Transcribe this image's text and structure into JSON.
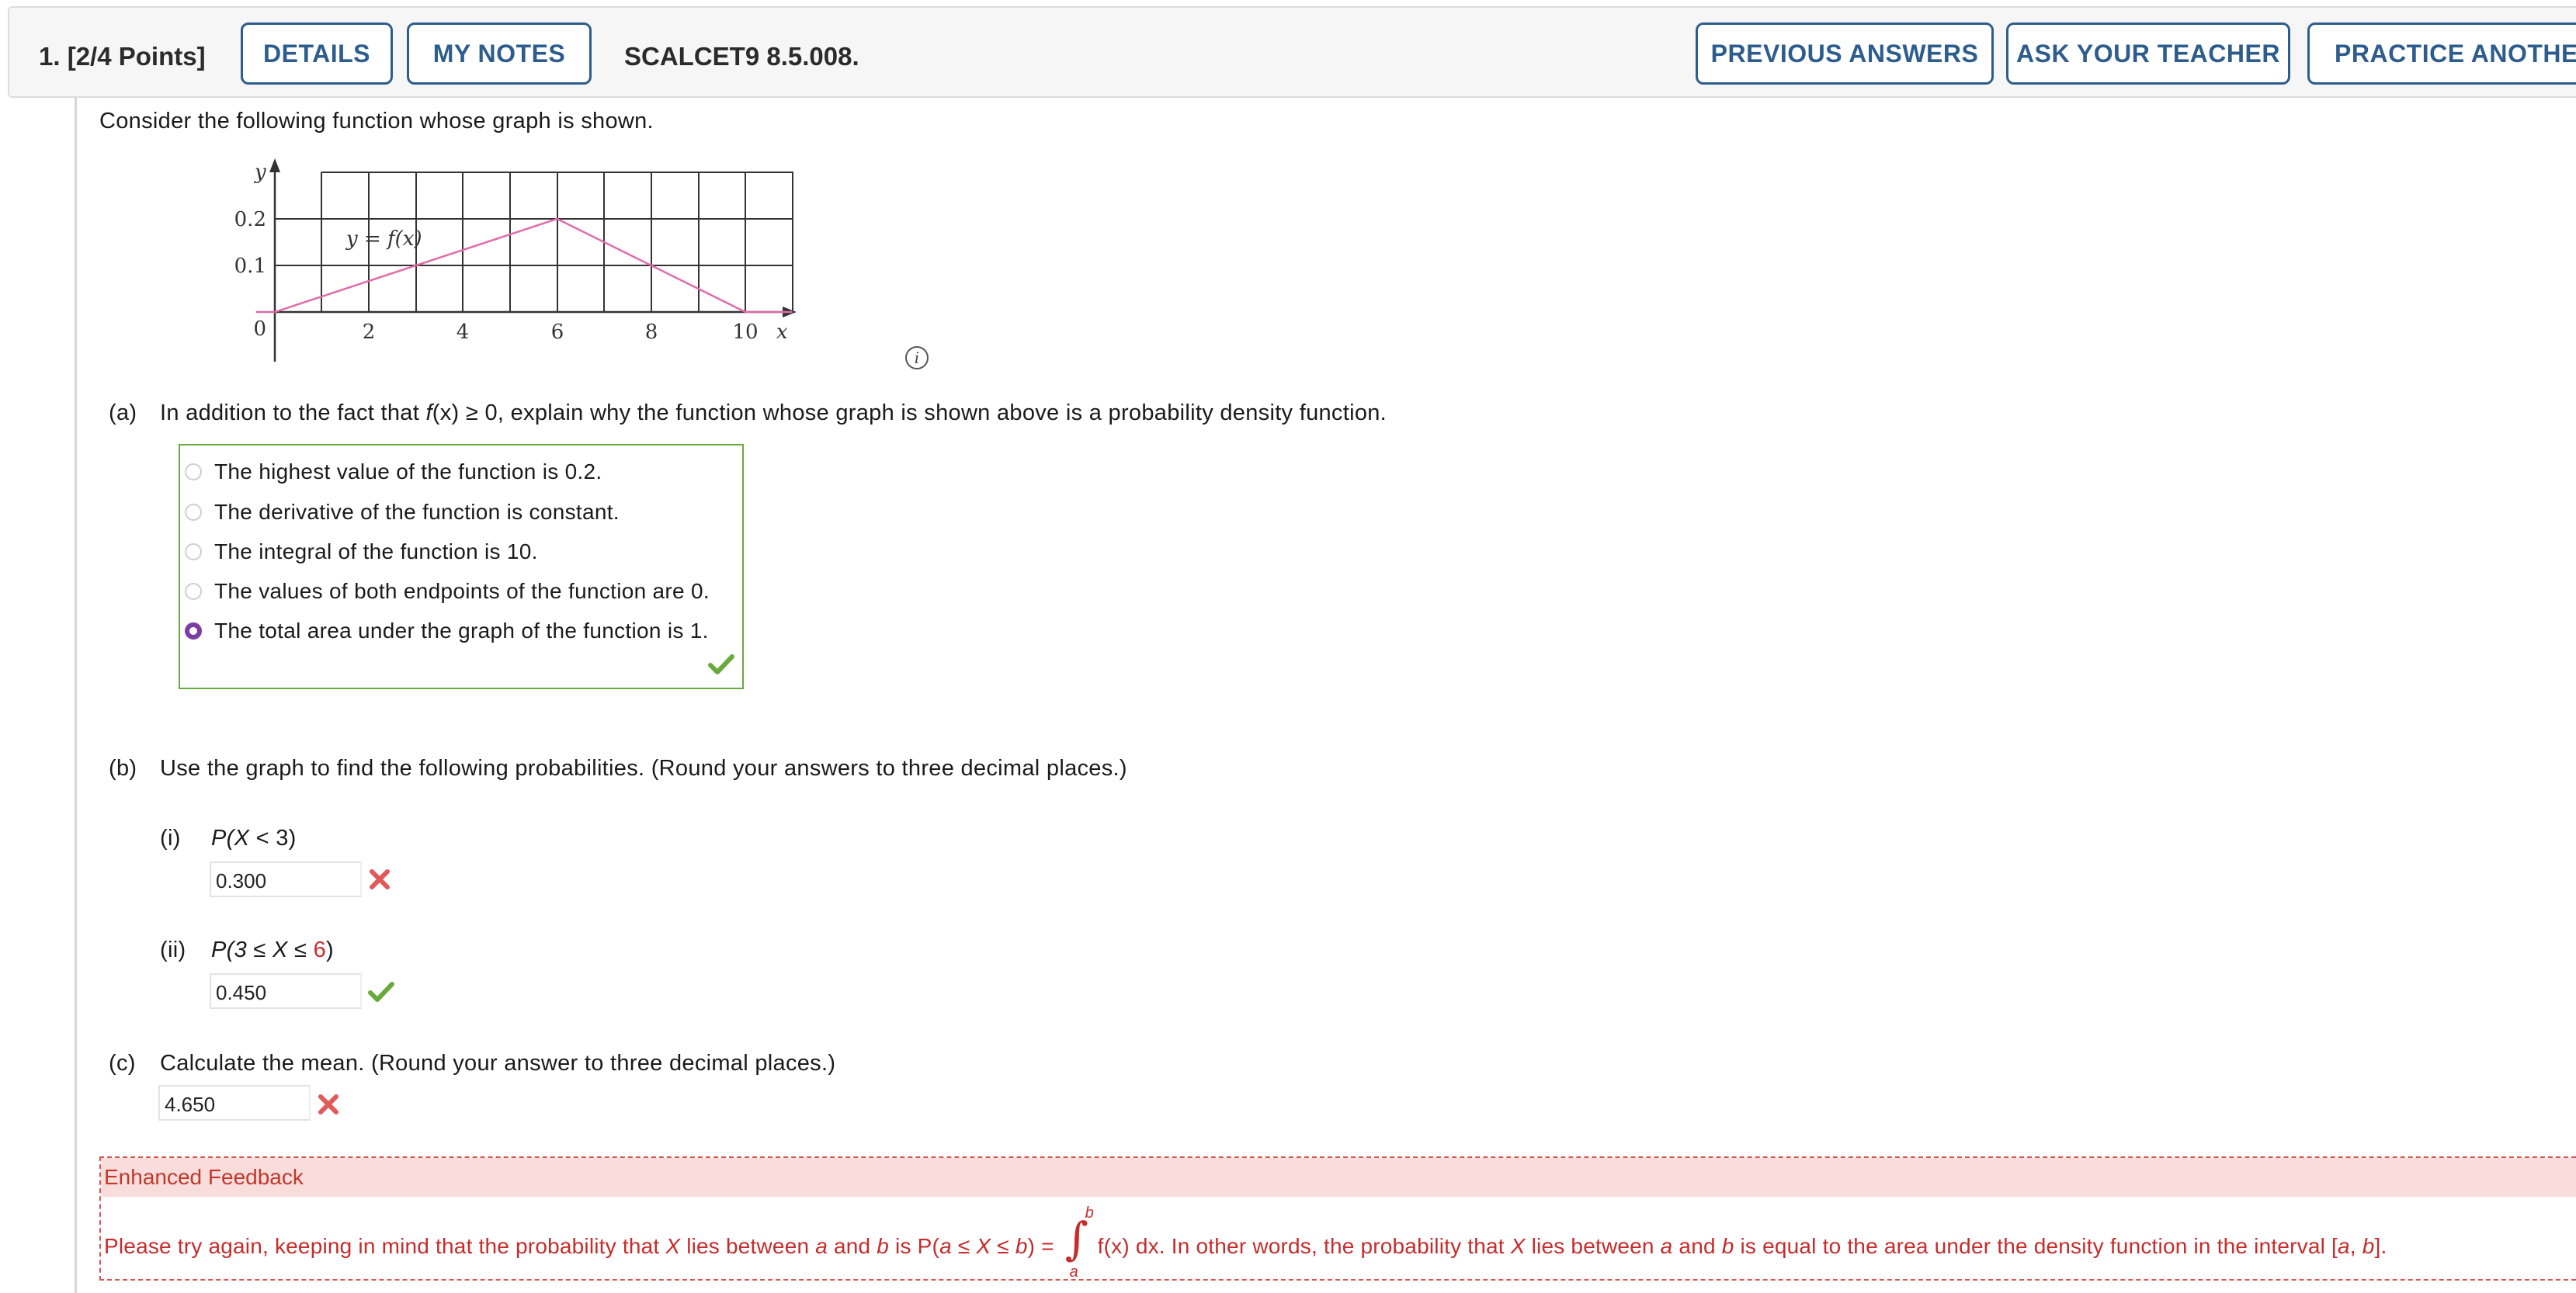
{
  "header": {
    "question_number": "1.",
    "points": "[2/4 Points]",
    "details_label": "DETAILS",
    "notes_label": "MY NOTES",
    "code": "SCALCET9 8.5.008.",
    "previous_answers_label": "PREVIOUS ANSWERS",
    "ask_teacher_label": "ASK YOUR TEACHER",
    "practice_another_label": "PRACTICE ANOTHER"
  },
  "intro": "Consider the following function whose graph is shown.",
  "graph": {
    "y_axis_label": "y",
    "x_axis_label": "x",
    "function_label": "y = f(x)",
    "y_ticks": [
      "0.2",
      "0.1",
      "0"
    ],
    "x_ticks": [
      "2",
      "4",
      "6",
      "8",
      "10"
    ],
    "line_color": "#e26aa8"
  },
  "chart_data": {
    "type": "line",
    "x": [
      0,
      6,
      10
    ],
    "y": [
      0,
      0.2,
      0
    ],
    "xlim": [
      0,
      11
    ],
    "ylim": [
      0,
      0.3
    ],
    "grid": true
  },
  "part_a": {
    "marker": "(a)",
    "question_prefix": "In addition to the fact that ",
    "question_fx": "f",
    "question_mid": "(x) ≥ 0, explain why the function whose graph is shown above is a probability density function.",
    "choices": [
      {
        "label": "The highest value of the function is 0.2.",
        "selected": false
      },
      {
        "label": "The derivative of the function is constant.",
        "selected": false
      },
      {
        "label": "The integral of the function is 10.",
        "selected": false
      },
      {
        "label": "The values of both endpoints of the function are 0.",
        "selected": false
      },
      {
        "label": "The total area under the graph of the function is 1.",
        "selected": true
      }
    ],
    "status": "correct"
  },
  "part_b": {
    "marker": "(b)",
    "question": "Use the graph to find the following probabilities. (Round your answers to three decimal places.)",
    "items": [
      {
        "marker": "(i)",
        "expr_pre": "P(",
        "expr_var": "X",
        "expr_post": " < 3)",
        "value": "0.300",
        "status": "incorrect"
      },
      {
        "marker": "(ii)",
        "expr_pre": "P(3 ≤ ",
        "expr_var": "X",
        "expr_mid": " ≤ ",
        "expr_red": "6",
        "expr_post": ")",
        "value": "0.450",
        "status": "correct"
      }
    ]
  },
  "part_c": {
    "marker": "(c)",
    "question": "Calculate the mean. (Round your answer to three decimal places.)",
    "value": "4.650",
    "status": "incorrect"
  },
  "feedback": {
    "title": "Enhanced Feedback",
    "text_1": "Please try again, keeping in mind that the probability that ",
    "x": "X",
    "text_2": " lies between ",
    "a": "a",
    "text_3": " and ",
    "b": "b",
    "text_4": " is ",
    "p_expr_pre": "P(",
    "p_expr_mid1": " ≤ ",
    "p_expr_mid2": " ≤ ",
    "p_expr_post": ") = ",
    "integrand": "f(x) dx",
    "text_5": ". In other words, the probability that ",
    "text_6": " lies between ",
    "text_7": " and ",
    "text_8": " is equal to the area under the density function in the interval [",
    "comma": ", ",
    "end": "]."
  },
  "colors": {
    "accent": "#2d5d8d",
    "correct": "#6aaa3c",
    "incorrect": "#e05a5a",
    "selected_radio": "#7b3fa4",
    "feedback_red": "#c72b2b"
  }
}
